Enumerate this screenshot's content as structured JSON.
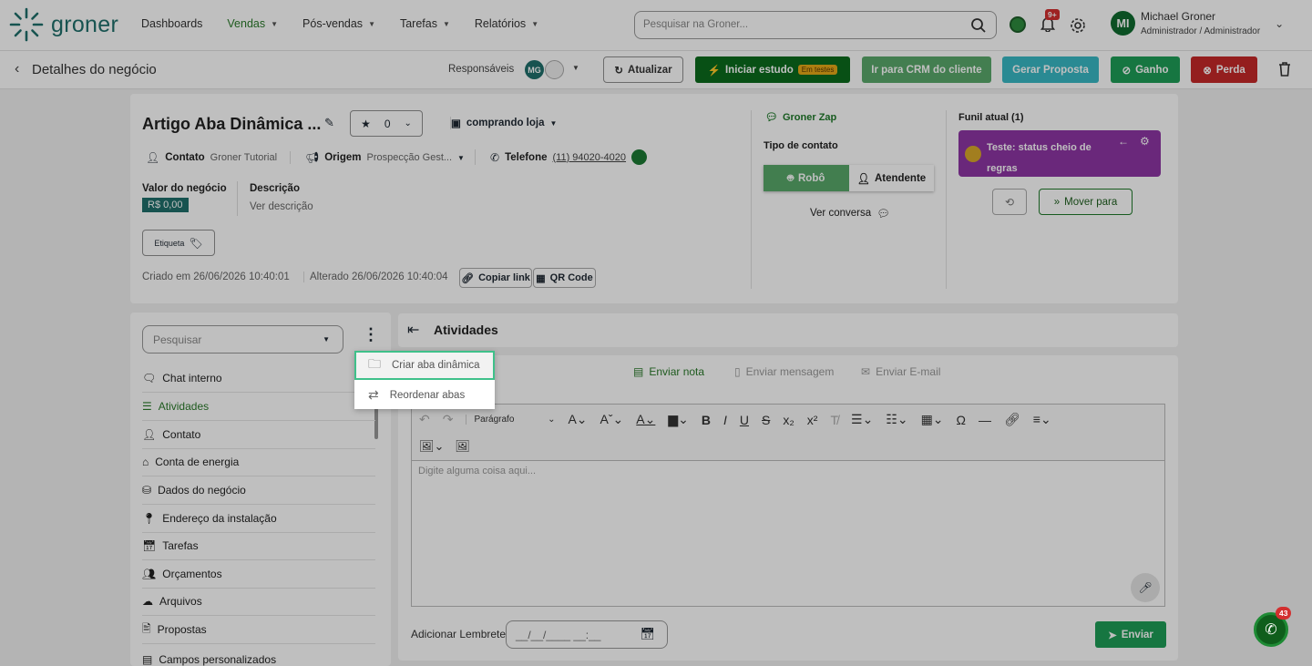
{
  "app": {
    "logo_text": "groner"
  },
  "nav": {
    "items": [
      {
        "label": "Dashboards"
      },
      {
        "label": "Vendas"
      },
      {
        "label": "Pós-vendas"
      },
      {
        "label": "Tarefas"
      },
      {
        "label": "Relatórios"
      }
    ]
  },
  "search": {
    "placeholder": "Pesquisar na Groner..."
  },
  "notifications": {
    "badge": "9+"
  },
  "user": {
    "initials": "MI",
    "name": "Michael Groner",
    "role": "Administrador / Administrador"
  },
  "subheader": {
    "title": "Detalhes do negócio",
    "responsaveis_label": "Responsáveis",
    "responsavel_initials": "MG",
    "buttons": {
      "atualizar": "Atualizar",
      "iniciar_estudo": "Iniciar estudo",
      "em_testes": "Em testes",
      "crm": "Ir para CRM do cliente",
      "proposta": "Gerar Proposta",
      "ganho": "Ganho",
      "perda": "Perda"
    }
  },
  "deal": {
    "title": "Artigo Aba Dinâmica ...",
    "rating": "0",
    "stage": "comprando loja",
    "contato_label": "Contato",
    "contato_value": "Groner Tutorial",
    "origem_label": "Origem",
    "origem_value": "Prospecção Gest...",
    "telefone_label": "Telefone",
    "telefone_value": "(11) 94020-4020",
    "valor_label": "Valor do negócio",
    "valor_value": "R$ 0,00",
    "descricao_label": "Descrição",
    "descricao_value": "Ver descrição",
    "etiqueta": "Etiqueta",
    "criado": "Criado em 26/06/2026 10:40:01",
    "alterado": "Alterado 26/06/2026 10:40:04",
    "copiar_link": "Copiar link",
    "qr_code": "QR Code"
  },
  "contact_panel": {
    "groner_zap": "Groner Zap",
    "tipo_label": "Tipo de contato",
    "robo": "Robô",
    "atendente": "Atendente",
    "ver_conversa": "Ver conversa"
  },
  "funnel": {
    "label": "Funil atual (1)",
    "card_title": "Teste: status cheio de regras",
    "mover": "Mover para"
  },
  "sidebar": {
    "search_placeholder": "Pesquisar",
    "items": [
      {
        "label": "Chat interno",
        "icon": "chat-icon"
      },
      {
        "label": "Atividades",
        "icon": "list-icon"
      },
      {
        "label": "Contato",
        "icon": "person-icon"
      },
      {
        "label": "Conta de energia",
        "icon": "house-icon"
      },
      {
        "label": "Dados do negócio",
        "icon": "database-icon"
      },
      {
        "label": "Endereço da instalação",
        "icon": "pin-icon"
      },
      {
        "label": "Tarefas",
        "icon": "calendar-icon"
      },
      {
        "label": "Orçamentos",
        "icon": "people-icon"
      },
      {
        "label": "Arquivos",
        "icon": "cloud-icon"
      },
      {
        "label": "Propostas",
        "icon": "document-icon"
      },
      {
        "label": "Campos personalizados",
        "icon": "fields-icon"
      }
    ]
  },
  "dropdown": {
    "items": [
      {
        "label": "Criar aba dinâmica"
      },
      {
        "label": "Reordenar abas"
      }
    ]
  },
  "activities": {
    "title": "Atividades",
    "tabs": {
      "nota": "Enviar nota",
      "mensagem": "Enviar mensagem",
      "email": "Enviar E-mail"
    },
    "editor": {
      "paragraph": "Parágrafo",
      "placeholder": "Digite alguma coisa aqui..."
    },
    "lembrete_label": "Adicionar Lembrete",
    "lembrete_placeholder": "__/__/____ __:__",
    "enviar": "Enviar"
  },
  "whatsapp_fab": {
    "badge": "43"
  },
  "colors": {
    "brand": "#1f6f6b",
    "green_dark": "#0b6b1d",
    "green": "#1e9e57",
    "crm_green": "#5aa96b",
    "teal": "#38b8c4",
    "red": "#c62828",
    "purple": "#8e36a5"
  }
}
